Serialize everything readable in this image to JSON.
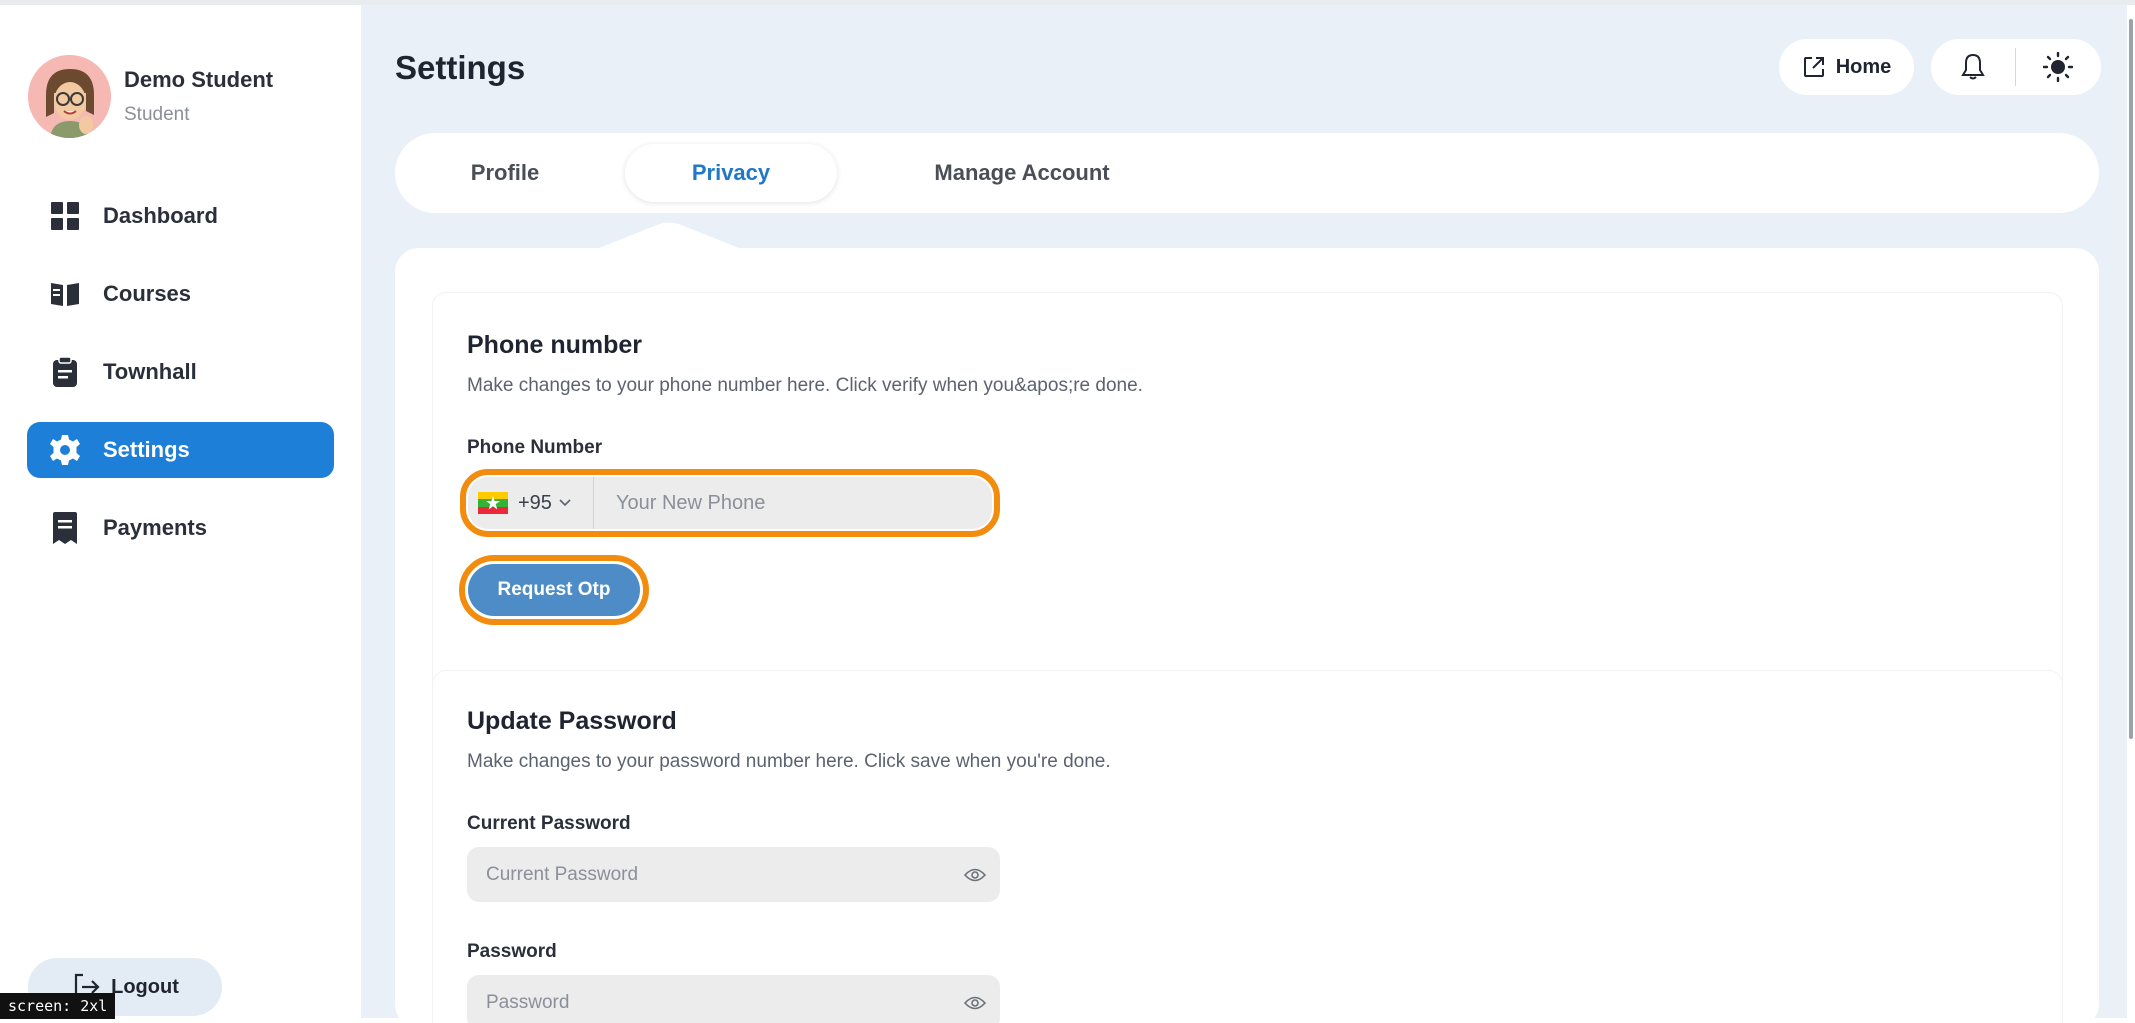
{
  "user": {
    "name": "Demo Student",
    "role": "Student"
  },
  "sidebar": {
    "items": [
      {
        "label": "Dashboard",
        "icon": "dashboard-grid-icon"
      },
      {
        "label": "Courses",
        "icon": "book-open-icon"
      },
      {
        "label": "Townhall",
        "icon": "clipboard-icon"
      },
      {
        "label": "Settings",
        "icon": "gear-icon",
        "active": true
      },
      {
        "label": "Payments",
        "icon": "receipt-icon"
      }
    ],
    "logout_label": "Logout"
  },
  "header": {
    "title": "Settings",
    "home_label": "Home"
  },
  "tabs": [
    {
      "label": "Profile"
    },
    {
      "label": "Privacy",
      "active": true
    },
    {
      "label": "Manage Account"
    }
  ],
  "phone_section": {
    "title": "Phone number",
    "description": "Make changes to your phone number here. Click verify when you&apos;re done.",
    "field_label": "Phone Number",
    "country_code": "+95",
    "placeholder": "Your New Phone",
    "value": "",
    "button_label": "Request Otp"
  },
  "password_section": {
    "title": "Update Password",
    "description": "Make changes to your password number here. Click save when you're done.",
    "current_label": "Current Password",
    "current_placeholder": "Current Password",
    "password_label": "Password",
    "password_placeholder": "Password"
  },
  "debug_badge": "screen: 2xl",
  "colors": {
    "accent": "#1e7fd9",
    "highlight_ring": "#f28c0f",
    "button": "#4e8cc7",
    "main_bg": "#e9f0f7"
  }
}
